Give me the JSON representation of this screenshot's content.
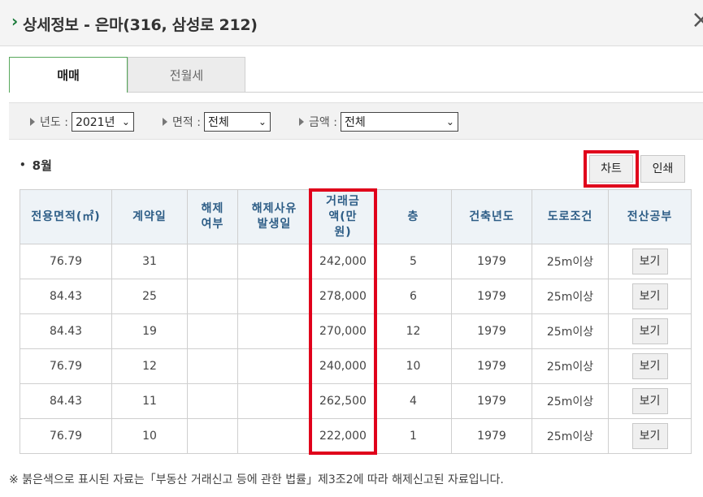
{
  "header": {
    "title": "상세정보 - 은마(316, 삼성로 212)",
    "chevron": "›",
    "close": "×"
  },
  "tabs": [
    {
      "label": "매매",
      "active": true
    },
    {
      "label": "전월세",
      "active": false
    }
  ],
  "filters": {
    "year": {
      "label": "년도 :",
      "value": "2021년"
    },
    "area": {
      "label": "면적 :",
      "value": "전체"
    },
    "price": {
      "label": "금액 :",
      "value": "전체"
    }
  },
  "month_label": "8월",
  "buttons": {
    "chart": "차트",
    "print": "인쇄"
  },
  "table": {
    "headers": [
      "전용면적(㎡)",
      "계약일",
      "해제\n여부",
      "해제사유\n발생일",
      "거래금\n액(만\n원)",
      "층",
      "건축년도",
      "도로조건",
      "전산공부"
    ],
    "rows": [
      {
        "area": "76.79",
        "day": "31",
        "cancel": "",
        "cancel_date": "",
        "price": "242,000",
        "floor": "5",
        "built": "1979",
        "road": "25m이상",
        "action": "보기"
      },
      {
        "area": "84.43",
        "day": "25",
        "cancel": "",
        "cancel_date": "",
        "price": "278,000",
        "floor": "6",
        "built": "1979",
        "road": "25m이상",
        "action": "보기"
      },
      {
        "area": "84.43",
        "day": "19",
        "cancel": "",
        "cancel_date": "",
        "price": "270,000",
        "floor": "12",
        "built": "1979",
        "road": "25m이상",
        "action": "보기"
      },
      {
        "area": "76.79",
        "day": "12",
        "cancel": "",
        "cancel_date": "",
        "price": "240,000",
        "floor": "10",
        "built": "1979",
        "road": "25m이상",
        "action": "보기"
      },
      {
        "area": "84.43",
        "day": "11",
        "cancel": "",
        "cancel_date": "",
        "price": "262,500",
        "floor": "4",
        "built": "1979",
        "road": "25m이상",
        "action": "보기"
      },
      {
        "area": "76.79",
        "day": "10",
        "cancel": "",
        "cancel_date": "",
        "price": "222,000",
        "floor": "1",
        "built": "1979",
        "road": "25m이상",
        "action": "보기"
      }
    ]
  },
  "footnote": "※ 붉은색으로 표시된 자료는「부동산 거래신고 등에 관한 법률」제3조2에 따라 해제신고된 자료입니다.",
  "colors": {
    "highlight": "#e0001b",
    "header_text": "#2d5d86",
    "active_tab_border": "#58a85c"
  }
}
